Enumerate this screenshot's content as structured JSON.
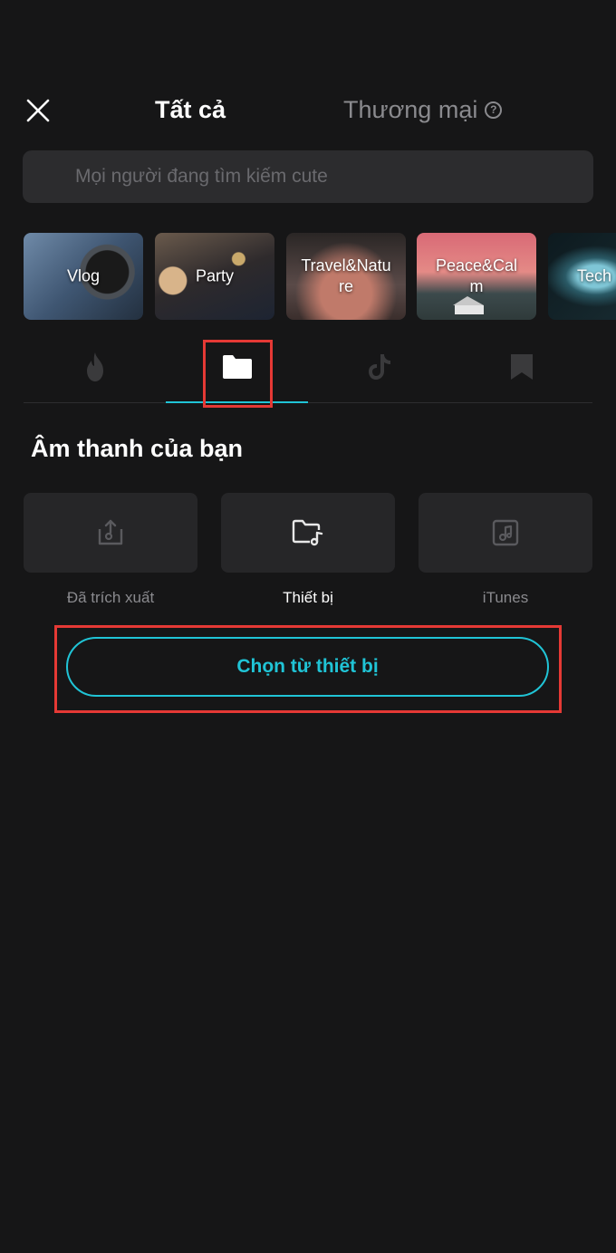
{
  "header": {
    "tabs": [
      {
        "label": "Tất cả",
        "active": true
      },
      {
        "label": "Thương mại",
        "active": false,
        "help_icon": "question-circle-icon"
      }
    ],
    "help_symbol": "?",
    "close_icon": "close-icon"
  },
  "search": {
    "placeholder": "Mọi người đang tìm kiếm cute"
  },
  "categories": [
    {
      "label": "Vlog"
    },
    {
      "label": "Party"
    },
    {
      "label": "Travel&Nature"
    },
    {
      "label": "Peace&Calm"
    },
    {
      "label": "Tech"
    }
  ],
  "category_labels_wrapped": {
    "travel": [
      "Travel&Natu",
      "re"
    ],
    "peace": [
      "Peace&Cal",
      "m"
    ]
  },
  "icon_tabs": [
    {
      "icon": "flame-icon",
      "active": false
    },
    {
      "icon": "folder-icon",
      "active": true
    },
    {
      "icon": "tiktok-icon",
      "active": false
    },
    {
      "icon": "bookmark-icon",
      "active": false
    }
  ],
  "section": {
    "title": "Âm thanh của bạn"
  },
  "sources": [
    {
      "label": "Đã trích xuất",
      "icon": "extract-icon",
      "active": false
    },
    {
      "label": "Thiết bị",
      "icon": "folder-music-icon",
      "active": true
    },
    {
      "label": "iTunes",
      "icon": "itunes-icon",
      "active": false
    }
  ],
  "choose_button": {
    "label": "Chọn từ thiết bị"
  },
  "colors": {
    "background": "#161617",
    "accent": "#20c4d6",
    "highlight": "#e53935",
    "surface": "#262628"
  }
}
